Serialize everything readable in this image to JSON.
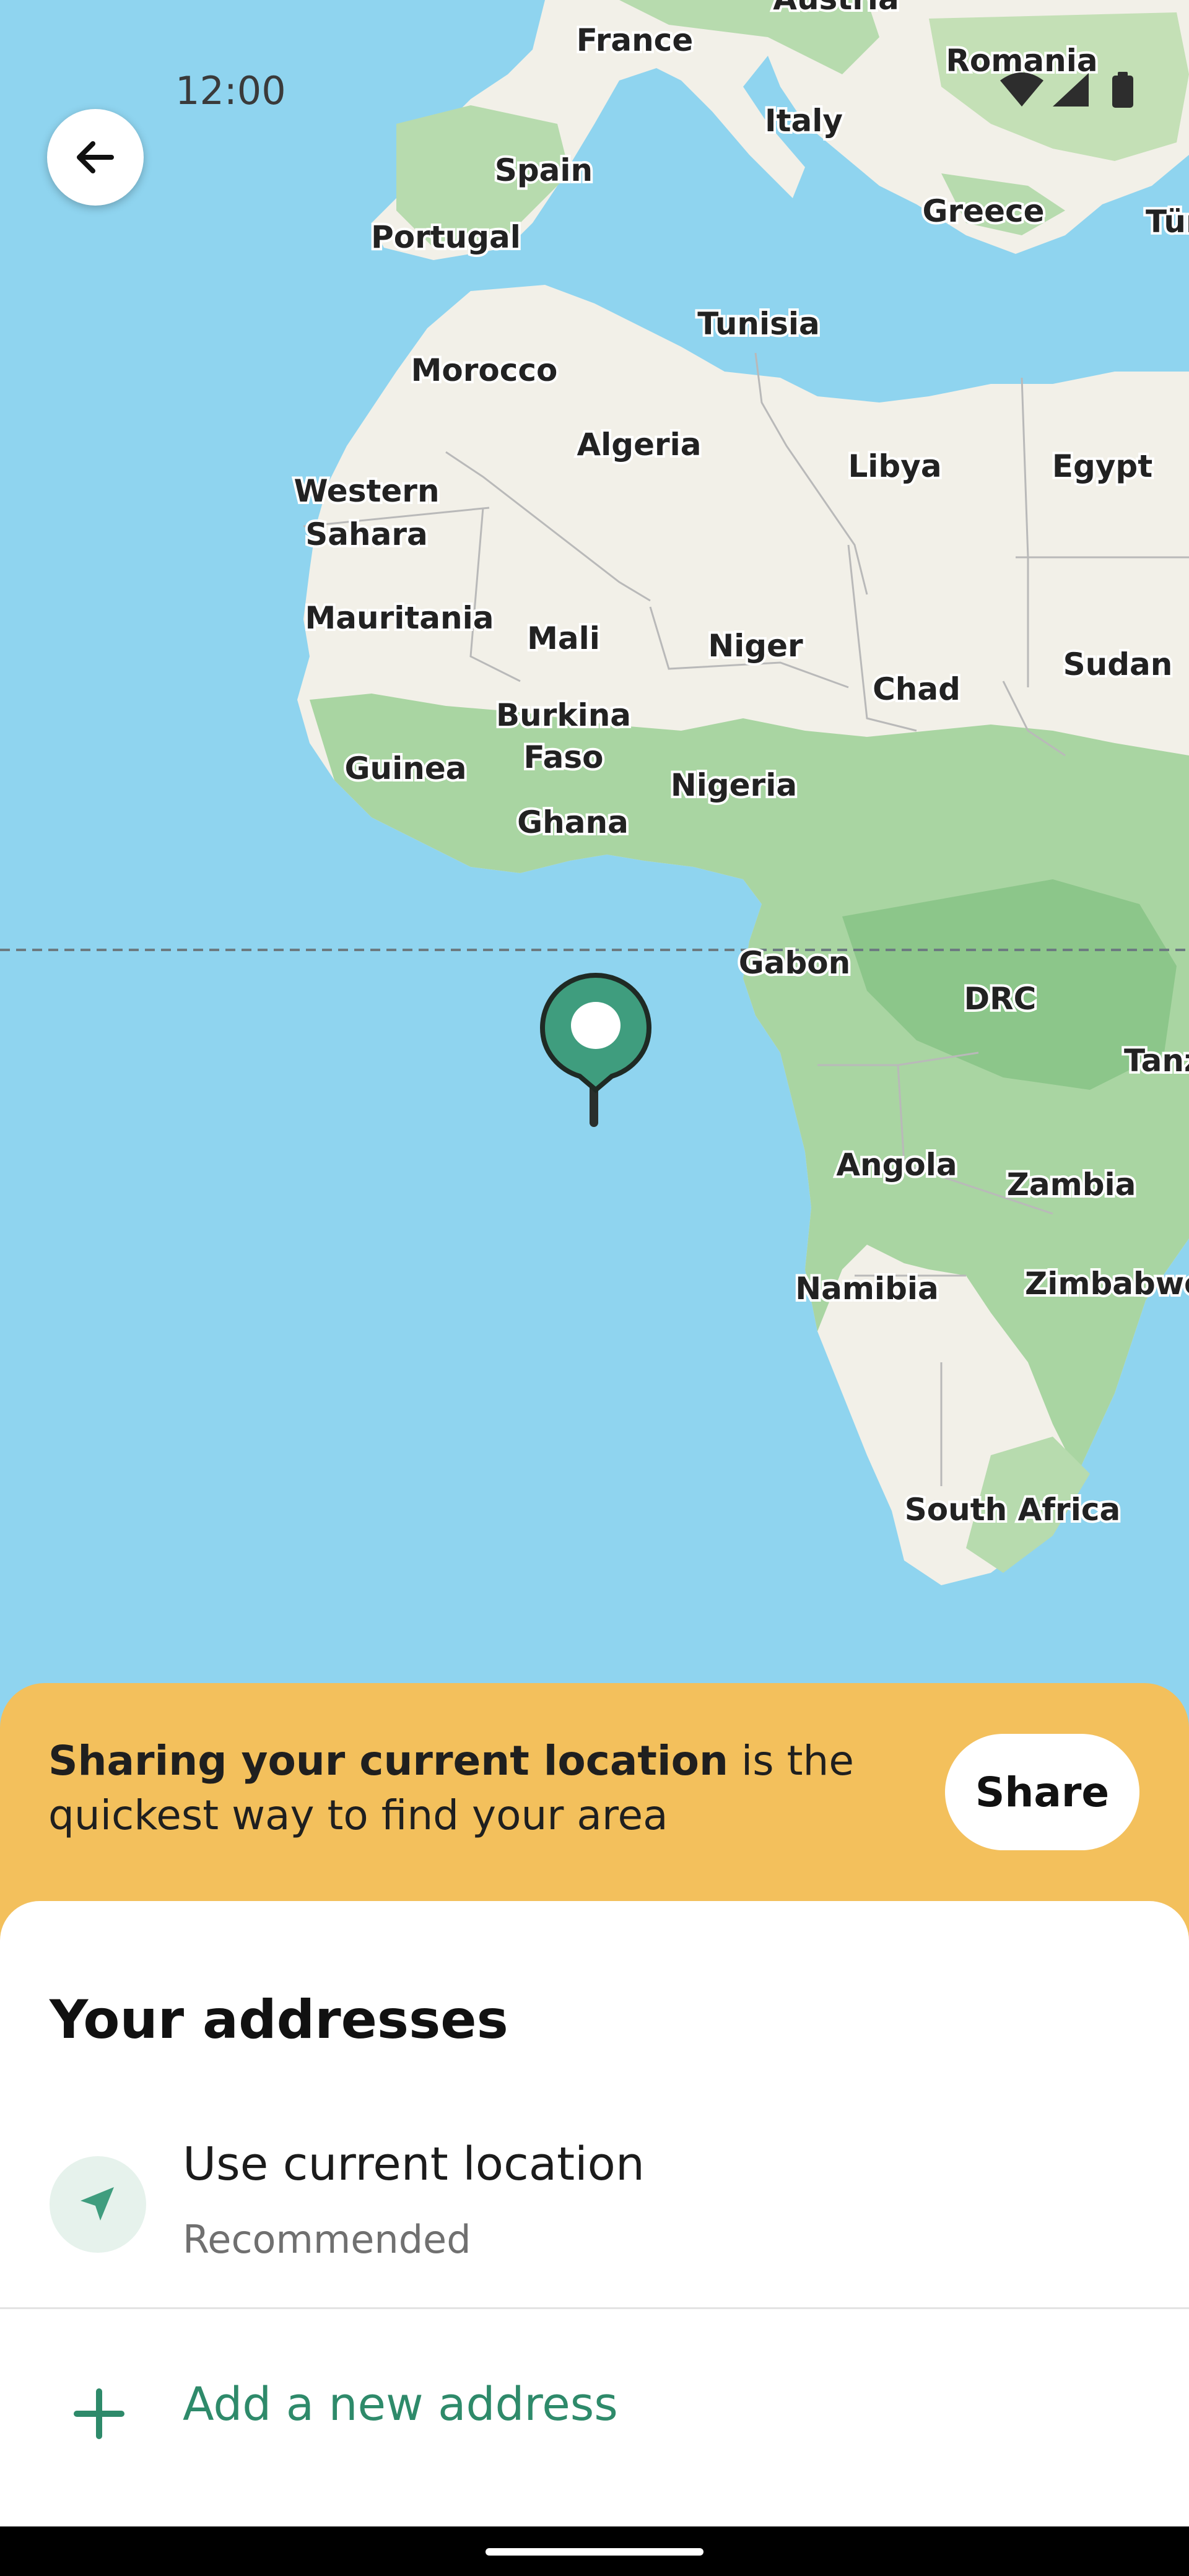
{
  "status_bar": {
    "time": "12:00"
  },
  "map": {
    "labels": {
      "austria": "Austria",
      "france": "France",
      "romania": "Romania",
      "italy": "Italy",
      "spain": "Spain",
      "portugal": "Portugal",
      "greece": "Greece",
      "turkey": "Tür",
      "tunisia": "Tunisia",
      "morocco": "Morocco",
      "algeria": "Algeria",
      "libya": "Libya",
      "egypt": "Egypt",
      "western_sahara_1": "Western",
      "western_sahara_2": "Sahara",
      "mauritania": "Mauritania",
      "mali": "Mali",
      "niger": "Niger",
      "chad": "Chad",
      "sudan": "Sudan",
      "burkina_1": "Burkina",
      "burkina_2": "Faso",
      "guinea": "Guinea",
      "nigeria": "Nigeria",
      "ghana": "Ghana",
      "gabon": "Gabon",
      "drc": "DRC",
      "tanzania": "Tanz",
      "angola": "Angola",
      "zambia": "Zambia",
      "namibia": "Namibia",
      "zimbabwe": "Zimbabwe",
      "south_africa": "South Africa"
    },
    "colors": {
      "water": "#8fd4ef",
      "land": "#f2f0e8",
      "green": "#a9d5a2",
      "pin": "#3f9d7e"
    }
  },
  "location_banner": {
    "bold_text": "Sharing your current location",
    "text": " is the quickest way to find your area",
    "share_label": "Share"
  },
  "addresses": {
    "title": "Your addresses",
    "current_location": {
      "title": "Use current location",
      "subtitle": "Recommended"
    },
    "add_label": "Add a new address"
  }
}
